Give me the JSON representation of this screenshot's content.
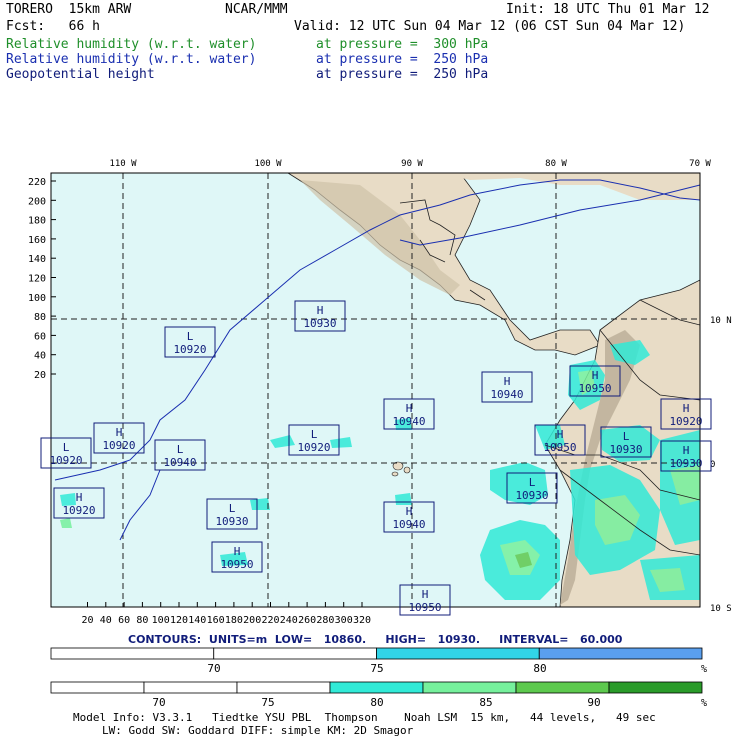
{
  "header": {
    "model": "TORERO  15km ARW",
    "org": "NCAR/MMM",
    "init": "Init: 18 UTC Thu 01 Mar 12",
    "fcst": "Fcst:   66 h",
    "valid": "Valid: 12 UTC Sun 04 Mar 12 (06 CST Sun 04 Mar 12)"
  },
  "fields": [
    {
      "name": "Relative humidity (w.r.t. water)",
      "level": "at pressure =  300 hPa",
      "color": "#1f8f2a"
    },
    {
      "name": "Relative humidity (w.r.t. water)",
      "level": "at pressure =  250 hPa",
      "color": "#1a2fb0"
    },
    {
      "name": "Geopotential height",
      "level": "at pressure =  250 hPa",
      "color": "#101c7a"
    }
  ],
  "map": {
    "top_lon_labels": [
      "110 W",
      "100 W",
      "90 W",
      "80 W",
      "70 W"
    ],
    "right_lat_labels": [
      "10 N",
      "0",
      "10 S"
    ],
    "y_ticks": [
      "220",
      "200",
      "180",
      "160",
      "140",
      "120",
      "100",
      "80",
      "60",
      "40",
      "20"
    ],
    "x_ticks": [
      "20",
      "40",
      "60",
      "80",
      "100",
      "120",
      "140",
      "160",
      "180",
      "200",
      "220",
      "240",
      "260",
      "280",
      "300",
      "320"
    ],
    "ocean_color": "#dff7f7",
    "land_color": "#e8dcc6",
    "pressure_centers": [
      {
        "type": "H",
        "value": "10930"
      },
      {
        "type": "L",
        "value": "10920"
      },
      {
        "type": "H",
        "value": "10940"
      },
      {
        "type": "H",
        "value": "10950"
      },
      {
        "type": "L",
        "value": "10930"
      },
      {
        "type": "L",
        "value": "10920"
      },
      {
        "type": "H",
        "value": "10940"
      },
      {
        "type": "H",
        "value": "10920"
      },
      {
        "type": "L",
        "value": "10940"
      },
      {
        "type": "H",
        "value": "10940"
      },
      {
        "type": "H",
        "value": "10950"
      },
      {
        "type": "L",
        "value": "10930"
      },
      {
        "type": "H",
        "value": "10920"
      },
      {
        "type": "L",
        "value": "10920"
      },
      {
        "type": "H",
        "value": "10950"
      },
      {
        "type": "H",
        "value": "10920"
      },
      {
        "type": "L",
        "value": "10930"
      },
      {
        "type": "H",
        "value": "10930"
      },
      {
        "type": "H",
        "value": "10950"
      }
    ]
  },
  "contours": {
    "label": "CONTOURS:",
    "units": "UNITS=m",
    "low": "LOW=   10860.",
    "high": "HIGH=   10930.",
    "interval": "INTERVAL=   60.000"
  },
  "colorbar_250": {
    "colors": [
      "#ffffff",
      "#ffffff",
      "#31d4e8",
      "#5a9fee"
    ],
    "labels": [
      "70",
      "75",
      "80"
    ],
    "unit": "%"
  },
  "colorbar_300": {
    "colors": [
      "#ffffff",
      "#ffffff",
      "#ffffff",
      "#31ead7",
      "#76f09c",
      "#5dc94e",
      "#2a9b2a"
    ],
    "labels": [
      "70",
      "75",
      "80",
      "85",
      "90"
    ],
    "unit": "%"
  },
  "footer": {
    "line1": "Model Info: V3.3.1   Tiedtke YSU PBL  Thompson    Noah LSM  15 km,   44 levels,   49 sec",
    "line2": "LW: Godd SW: Goddard DIFF: simple KM: 2D Smagor"
  }
}
